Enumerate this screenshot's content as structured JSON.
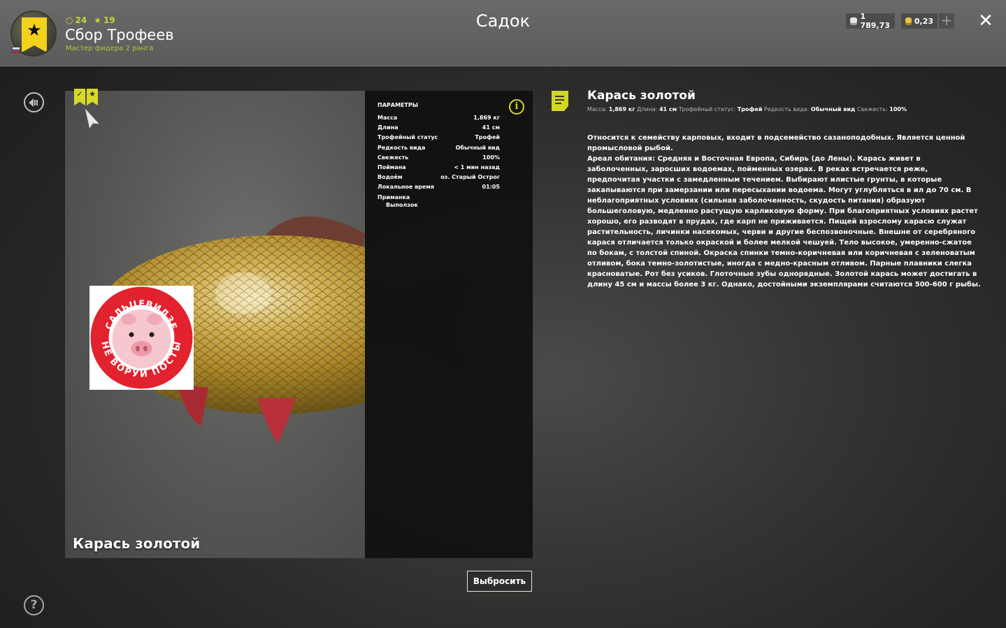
{
  "header": {
    "title": "Садок",
    "player": {
      "name": "Сбор Трофеев",
      "rank": "Мастер фидера 2 ранга",
      "level": "24",
      "stars": "19"
    },
    "currency": {
      "silver": "1 789,73",
      "gold": "0,23"
    },
    "plus_label": "+",
    "close_label": "✕"
  },
  "fish": {
    "name": "Карась золотой"
  },
  "params": {
    "title": "ПАРАМЕТРЫ",
    "rows": [
      {
        "label": "Масса",
        "value": "1,869 кг"
      },
      {
        "label": "Длина",
        "value": "41 см"
      },
      {
        "label": "Трофейный статус",
        "value": "Трофей"
      },
      {
        "label": "Редкость вида",
        "value": "Обычный вид"
      },
      {
        "label": "Свежесть",
        "value": "100%"
      },
      {
        "label": "Поймана",
        "value": "< 1 мин назад"
      },
      {
        "label": "Водоём",
        "value": "оз. Старый Острог"
      },
      {
        "label": "Локальное время",
        "value": "01:05"
      }
    ],
    "bait_label": "Приманка",
    "bait_value": "Выползок"
  },
  "description": {
    "title": "Карась золотой",
    "meta": [
      {
        "label": "Масса:",
        "value": "1,869 кг"
      },
      {
        "label": "Длина:",
        "value": "41 см"
      },
      {
        "label": "Трофейный статус:",
        "value": "Трофей"
      },
      {
        "label": "Редкость вида:",
        "value": "Обычный вид"
      },
      {
        "label": "Свежесть:",
        "value": "100%"
      }
    ],
    "paragraphs": [
      "Относится к семейству карповых, входит в подсемейство сазаноподобных. Является ценной промысловой рыбой.",
      "Ареал обитания: Средняя и Восточная Европа, Сибирь (до Лены). Карась живет в заболоченных, заросших водоемах, пойменных озерах. В реках встречается реже, предпочитая участки с замедленным течением. Выбирают илистые грунты, в которые закапываются при замерзании или пересыхании водоема. Могут углубляться в ил до 70 см. В неблагоприятных условиях (сильная заболоченность, скудость питания) образуют большеголовую, медленно растущую карликовую форму. При благоприятных условиях растет хорошо, его разводят в прудах, где карп не приживается. Пищей взрослому карасю служат растительность, личинки насекомых, черви и другие беспозвоночные. Внешне от серебряного карася отличается только окраской и более мелкой чешуей. Тело высокое, умеренно-сжатое по бокам, с толстой спиной. Окраска спинки темно-коричневая или коричневая с зеленоватым отливом, бока темно-золотистые, иногда с медно-красным отливом. Парные плавники слегка красноватые. Рот без усиков. Глоточные зубы однорядные. Золотой карась может достигать в длину 45 см и массы более 3 кг. Однако, достойными экземплярами считаются 500-600 г рыбы."
    ]
  },
  "actions": {
    "release_label": "Выбросить"
  },
  "sticker": {
    "top_text": "САЛЬЦЕВИДЗЕ",
    "bottom_text": "НЕ ВОРУЙ ПОСТЫ"
  },
  "colors": {
    "accent": "#d6d928",
    "panel_dark": "#101010",
    "header_bg": "#5f5f5f"
  }
}
